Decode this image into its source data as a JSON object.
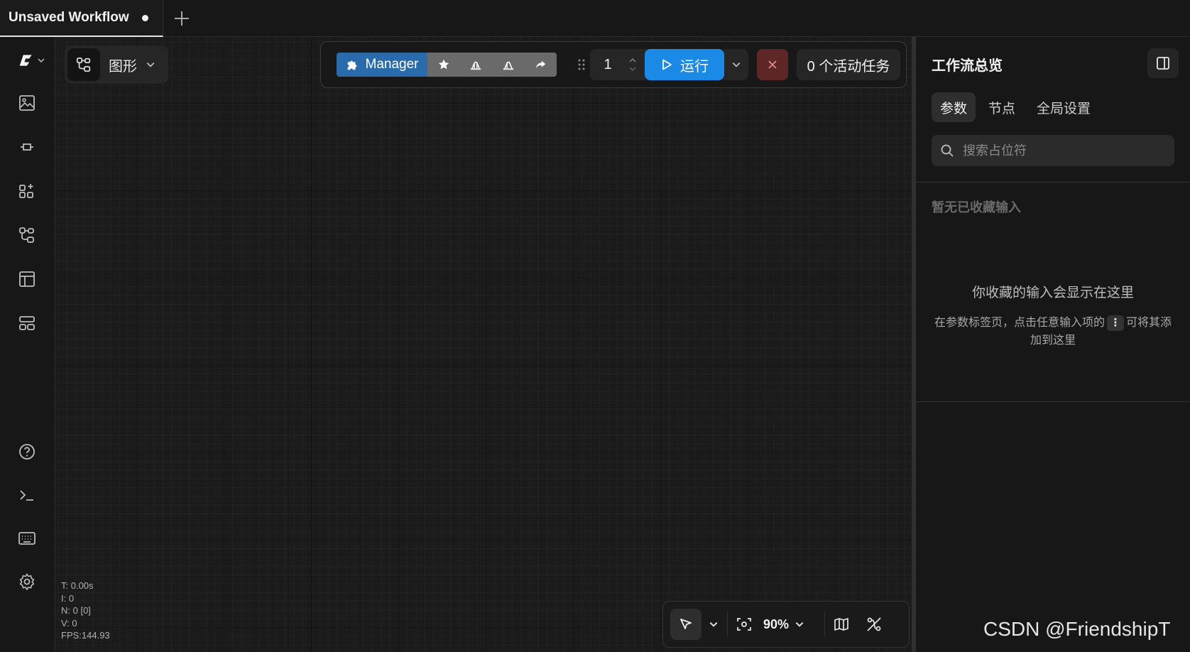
{
  "tabs": [
    {
      "label": "Unsaved Workflow",
      "unsaved": true
    }
  ],
  "sidebar": {
    "logo": "comfy-logo-icon",
    "items": [
      "images-icon",
      "model-library-icon",
      "node-library-icon",
      "workflows-icon",
      "templates-icon",
      "queue-icon"
    ],
    "bottom_items": [
      "help-icon",
      "terminal-icon",
      "keyboard-icon",
      "settings-icon"
    ]
  },
  "canvas": {
    "graph_picker": {
      "label": "图形"
    },
    "toolbar": {
      "manager_label": "Manager",
      "queue_count": "1",
      "run_label": "运行",
      "active_tasks": "0 个活动任务"
    },
    "stats": {
      "t": "T: 0.00s",
      "i": "I: 0",
      "n": "N: 0 [0]",
      "v": "V: 0",
      "fps": "FPS:144.93"
    },
    "bottom_toolbar": {
      "zoom": "90%"
    }
  },
  "panel": {
    "title": "工作流总览",
    "tabs": [
      {
        "label": "参数",
        "active": true
      },
      {
        "label": "节点",
        "active": false
      },
      {
        "label": "全局设置",
        "active": false
      }
    ],
    "search": {
      "placeholder": "搜索占位符",
      "value": ""
    },
    "empty_heading": "暂无已收藏输入",
    "empty_title": "你收藏的输入会显示在这里",
    "empty_desc_before": "在参数标签页，点击任意输入项的",
    "empty_desc_after": "可将其添加到这里"
  },
  "watermark": "CSDN @FriendshipT",
  "colors": {
    "accent": "#1b8ae6",
    "manager": "#2a6cab",
    "stop": "#5e2626",
    "background": "#1a1a1a"
  }
}
